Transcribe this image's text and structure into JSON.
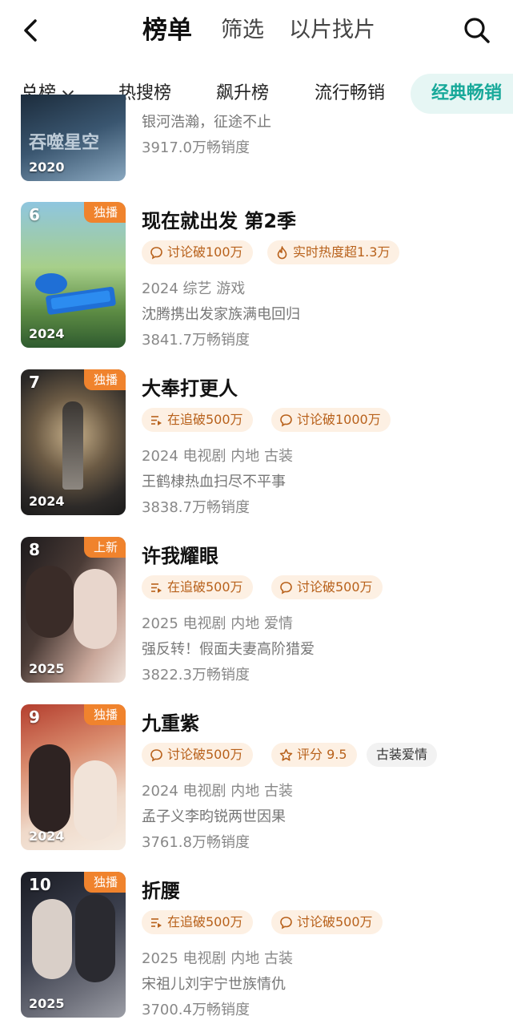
{
  "header": {
    "tabs": [
      {
        "label": "榜单",
        "active": true
      },
      {
        "label": "筛选",
        "active": false
      },
      {
        "label": "以片找片",
        "active": false
      }
    ]
  },
  "subtabs": [
    {
      "label": "总榜",
      "active": false
    },
    {
      "label": "热搜榜",
      "active": false
    },
    {
      "label": "飙升榜",
      "active": false
    },
    {
      "label": "流行畅销",
      "active": false
    },
    {
      "label": "经典畅销",
      "active": true
    }
  ],
  "items": [
    {
      "rank": "",
      "badge": "",
      "year": "2020",
      "poster_text": "吞噬星空",
      "title": "",
      "tags": [],
      "meta": "",
      "desc": "银河浩瀚，征途不止",
      "sales": "3917.0万畅销度"
    },
    {
      "rank": "6",
      "badge": "独播",
      "year": "2024",
      "poster_text": "",
      "title": "现在就出发 第2季",
      "tags": [
        {
          "icon": "chat-bubble-icon",
          "label": "讨论破100万",
          "style": "orange"
        },
        {
          "icon": "flame-icon",
          "label": "实时热度超1.3万",
          "style": "orange"
        }
      ],
      "meta": "2024 综艺 游戏",
      "desc": "沈腾携出发家族满电回归",
      "sales": "3841.7万畅销度"
    },
    {
      "rank": "7",
      "badge": "独播",
      "year": "2024",
      "poster_text": "",
      "title": "大奉打更人",
      "tags": [
        {
          "icon": "list-play-icon",
          "label": "在追破500万",
          "style": "orange"
        },
        {
          "icon": "chat-bubble-icon",
          "label": "讨论破1000万",
          "style": "orange"
        }
      ],
      "meta": "2024 电视剧 内地 古装",
      "desc": "王鹤棣热血扫尽不平事",
      "sales": "3838.7万畅销度"
    },
    {
      "rank": "8",
      "badge": "上新",
      "year": "2025",
      "poster_text": "",
      "title": "许我耀眼",
      "tags": [
        {
          "icon": "list-play-icon",
          "label": "在追破500万",
          "style": "orange"
        },
        {
          "icon": "chat-bubble-icon",
          "label": "讨论破500万",
          "style": "orange"
        }
      ],
      "meta": "2025 电视剧 内地 爱情",
      "desc": "强反转！假面夫妻高阶猎爱",
      "sales": "3822.3万畅销度"
    },
    {
      "rank": "9",
      "badge": "独播",
      "year": "2024",
      "poster_text": "",
      "title": "九重紫",
      "tags": [
        {
          "icon": "chat-bubble-icon",
          "label": "讨论破500万",
          "style": "orange"
        },
        {
          "icon": "star-icon",
          "label": "评分 9.5",
          "style": "orange"
        },
        {
          "icon": "",
          "label": "古装爱情",
          "style": "grey"
        }
      ],
      "meta": "2024 电视剧 内地 古装",
      "desc": "孟子义李昀锐两世因果",
      "sales": "3761.8万畅销度"
    },
    {
      "rank": "10",
      "badge": "独播",
      "year": "2025",
      "poster_text": "",
      "title": "折腰",
      "tags": [
        {
          "icon": "list-play-icon",
          "label": "在追破500万",
          "style": "orange"
        },
        {
          "icon": "chat-bubble-icon",
          "label": "讨论破500万",
          "style": "orange"
        }
      ],
      "meta": "2025 电视剧 内地 古装",
      "desc": "宋祖儿刘宇宁世族情仇",
      "sales": "3700.4万畅销度"
    }
  ],
  "colors": {
    "accent": "#18a99a",
    "badge": "#f0832d",
    "tag_bg": "#fdf0e3",
    "tag_text": "#b8611b"
  }
}
